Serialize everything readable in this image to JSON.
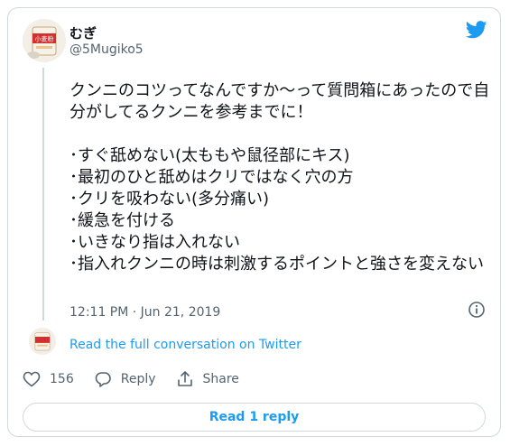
{
  "tweet": {
    "author_name": "むぎ",
    "author_handle": "@5Mugiko5",
    "text": "クンニのコツってなんですか〜って質問箱にあったので自分がしてるクンニを参考までに！\n\n･すぐ舐めない(太ももや鼠径部にキス)\n･最初のひと舐めはクリではなく穴の方\n･クリを吸わない(多分痛い)\n･緩急を付ける\n･いきなり指は入れない\n･指入れクンニの時は刺激するポイントと強さを変えない",
    "timestamp": "12:11 PM · Jun 21, 2019"
  },
  "conversation": {
    "link_label": "Read the full conversation on Twitter"
  },
  "actions": {
    "like_count": "156",
    "reply_label": "Reply",
    "share_label": "Share"
  },
  "footer": {
    "read_replies_label": "Read 1 reply"
  },
  "avatar": {
    "sign_text": "小麦粉"
  },
  "colors": {
    "accent": "#1d9bf0",
    "muted": "#536471",
    "border": "#cfd9de"
  },
  "icons": [
    "twitter-bird-icon",
    "info-icon",
    "heart-icon",
    "reply-icon",
    "share-icon"
  ]
}
